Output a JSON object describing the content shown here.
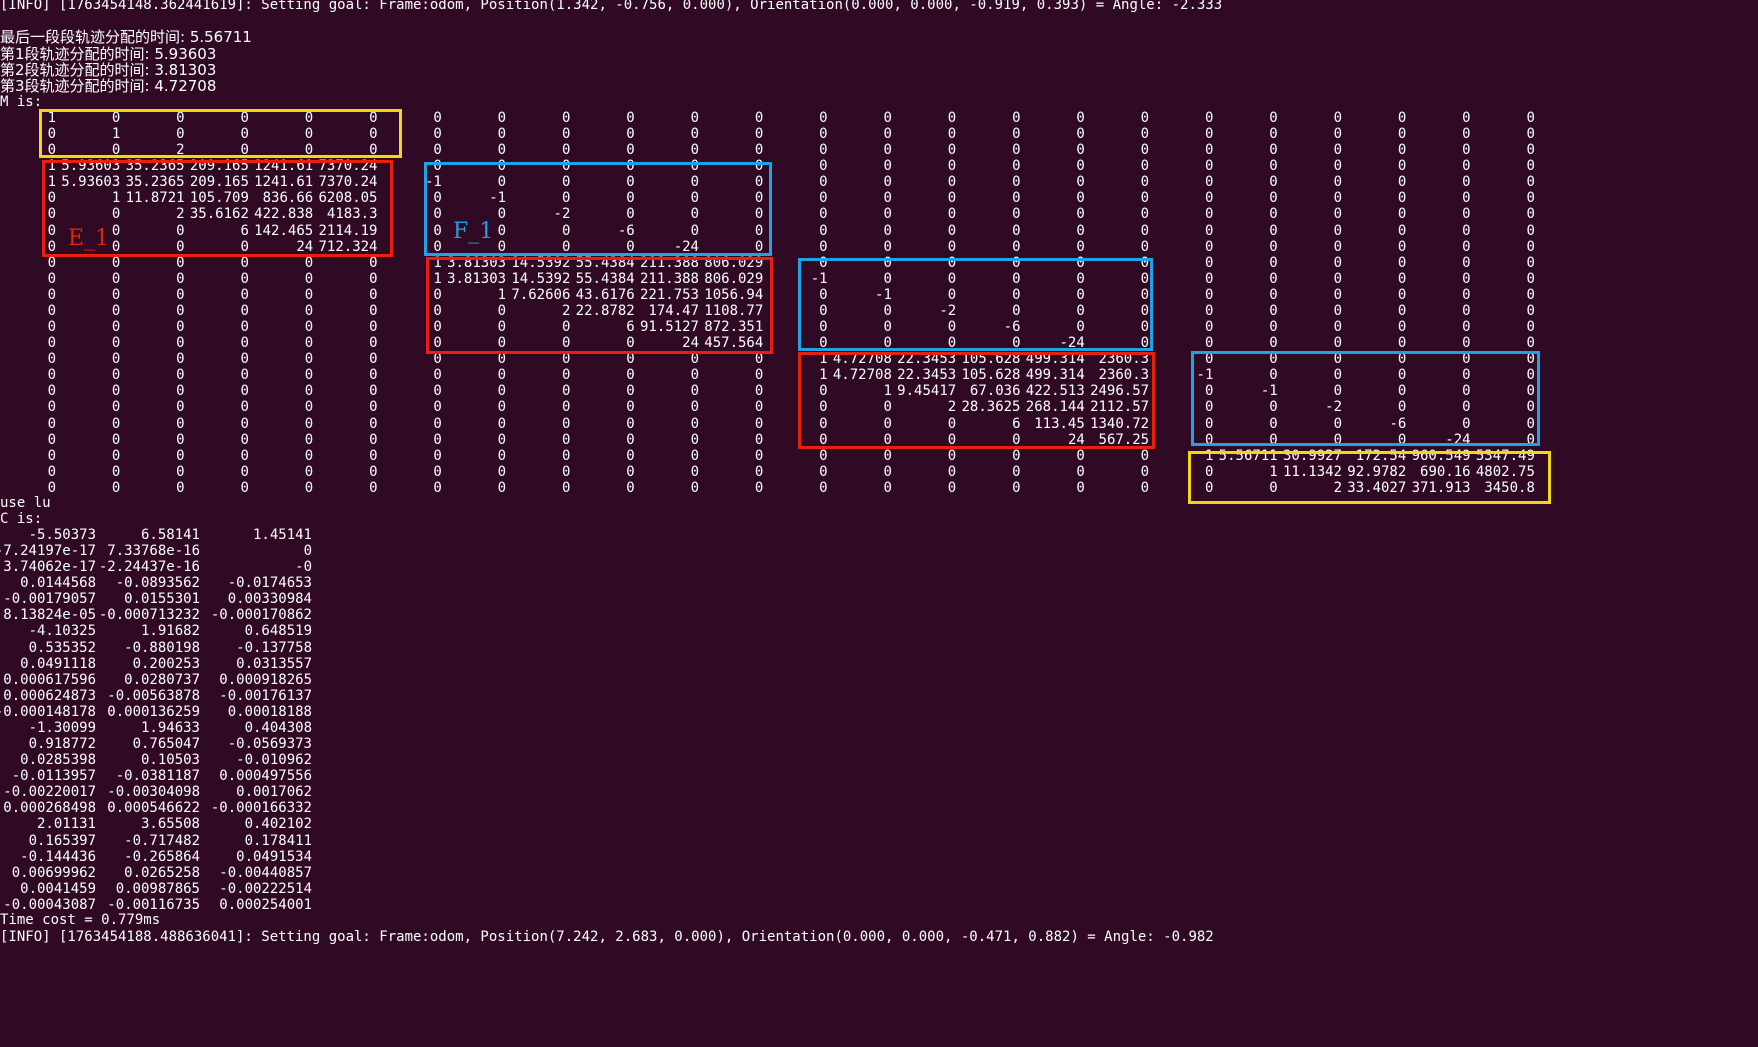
{
  "terminal": {
    "colors": {
      "background": "#300a24",
      "text": "#ffffff",
      "box_red": "#e8200e",
      "box_blue": "#1ea3e6",
      "box_yellow": "#f5d70d",
      "label_red": "#e8200e",
      "label_blue": "#1ea3e6"
    },
    "info_line": "[INFO] [1763454148.362441619]: Setting goal: Frame:odom, Position(1.342, -0.756, 0.000), Orientation(0.000, 0.000, -0.919, 0.393) = Angle: -2.333",
    "time_lines": [
      "最后一段段轨迹分配的时间: 5.56711",
      "第1段轨迹分配的时间: 5.93603",
      "第2段轨迹分配的时间: 3.81303",
      "第3段轨迹分配的时间: 4.72708"
    ],
    "m_header": "M is:",
    "m_rows": [
      [
        "1",
        "0",
        "0",
        "0",
        "0",
        "0",
        "0",
        "0",
        "0",
        "0",
        "0",
        "0",
        "0",
        "0",
        "0",
        "0",
        "0",
        "0",
        "0",
        "0",
        "0",
        "0",
        "0",
        "0"
      ],
      [
        "0",
        "1",
        "0",
        "0",
        "0",
        "0",
        "0",
        "0",
        "0",
        "0",
        "0",
        "0",
        "0",
        "0",
        "0",
        "0",
        "0",
        "0",
        "0",
        "0",
        "0",
        "0",
        "0",
        "0"
      ],
      [
        "0",
        "0",
        "2",
        "0",
        "0",
        "0",
        "0",
        "0",
        "0",
        "0",
        "0",
        "0",
        "0",
        "0",
        "0",
        "0",
        "0",
        "0",
        "0",
        "0",
        "0",
        "0",
        "0",
        "0"
      ],
      [
        "1",
        "5.93603",
        "35.2365",
        "209.165",
        "1241.61",
        "7370.24",
        "0",
        "0",
        "0",
        "0",
        "0",
        "0",
        "0",
        "0",
        "0",
        "0",
        "0",
        "0",
        "0",
        "0",
        "0",
        "0",
        "0",
        "0"
      ],
      [
        "1",
        "5.93603",
        "35.2365",
        "209.165",
        "1241.61",
        "7370.24",
        "-1",
        "0",
        "0",
        "0",
        "0",
        "0",
        "0",
        "0",
        "0",
        "0",
        "0",
        "0",
        "0",
        "0",
        "0",
        "0",
        "0",
        "0"
      ],
      [
        "0",
        "1",
        "11.8721",
        "105.709",
        "836.66",
        "6208.05",
        "0",
        "-1",
        "0",
        "0",
        "0",
        "0",
        "0",
        "0",
        "0",
        "0",
        "0",
        "0",
        "0",
        "0",
        "0",
        "0",
        "0",
        "0"
      ],
      [
        "0",
        "0",
        "2",
        "35.6162",
        "422.838",
        "4183.3",
        "0",
        "0",
        "-2",
        "0",
        "0",
        "0",
        "0",
        "0",
        "0",
        "0",
        "0",
        "0",
        "0",
        "0",
        "0",
        "0",
        "0",
        "0"
      ],
      [
        "0",
        "0",
        "0",
        "6",
        "142.465",
        "2114.19",
        "0",
        "0",
        "0",
        "-6",
        "0",
        "0",
        "0",
        "0",
        "0",
        "0",
        "0",
        "0",
        "0",
        "0",
        "0",
        "0",
        "0",
        "0"
      ],
      [
        "0",
        "0",
        "0",
        "0",
        "24",
        "712.324",
        "0",
        "0",
        "0",
        "0",
        "-24",
        "0",
        "0",
        "0",
        "0",
        "0",
        "0",
        "0",
        "0",
        "0",
        "0",
        "0",
        "0",
        "0"
      ],
      [
        "0",
        "0",
        "0",
        "0",
        "0",
        "0",
        "1",
        "3.81303",
        "14.5392",
        "55.4384",
        "211.388",
        "806.029",
        "0",
        "0",
        "0",
        "0",
        "0",
        "0",
        "0",
        "0",
        "0",
        "0",
        "0",
        "0"
      ],
      [
        "0",
        "0",
        "0",
        "0",
        "0",
        "0",
        "1",
        "3.81303",
        "14.5392",
        "55.4384",
        "211.388",
        "806.029",
        "-1",
        "0",
        "0",
        "0",
        "0",
        "0",
        "0",
        "0",
        "0",
        "0",
        "0",
        "0"
      ],
      [
        "0",
        "0",
        "0",
        "0",
        "0",
        "0",
        "0",
        "1",
        "7.62606",
        "43.6176",
        "221.753",
        "1056.94",
        "0",
        "-1",
        "0",
        "0",
        "0",
        "0",
        "0",
        "0",
        "0",
        "0",
        "0",
        "0"
      ],
      [
        "0",
        "0",
        "0",
        "0",
        "0",
        "0",
        "0",
        "0",
        "2",
        "22.8782",
        "174.47",
        "1108.77",
        "0",
        "0",
        "-2",
        "0",
        "0",
        "0",
        "0",
        "0",
        "0",
        "0",
        "0",
        "0"
      ],
      [
        "0",
        "0",
        "0",
        "0",
        "0",
        "0",
        "0",
        "0",
        "0",
        "6",
        "91.5127",
        "872.351",
        "0",
        "0",
        "0",
        "-6",
        "0",
        "0",
        "0",
        "0",
        "0",
        "0",
        "0",
        "0"
      ],
      [
        "0",
        "0",
        "0",
        "0",
        "0",
        "0",
        "0",
        "0",
        "0",
        "0",
        "24",
        "457.564",
        "0",
        "0",
        "0",
        "0",
        "-24",
        "0",
        "0",
        "0",
        "0",
        "0",
        "0",
        "0"
      ],
      [
        "0",
        "0",
        "0",
        "0",
        "0",
        "0",
        "0",
        "0",
        "0",
        "0",
        "0",
        "0",
        "1",
        "4.72708",
        "22.3453",
        "105.628",
        "499.314",
        "2360.3",
        "0",
        "0",
        "0",
        "0",
        "0",
        "0"
      ],
      [
        "0",
        "0",
        "0",
        "0",
        "0",
        "0",
        "0",
        "0",
        "0",
        "0",
        "0",
        "0",
        "1",
        "4.72708",
        "22.3453",
        "105.628",
        "499.314",
        "2360.3",
        "-1",
        "0",
        "0",
        "0",
        "0",
        "0"
      ],
      [
        "0",
        "0",
        "0",
        "0",
        "0",
        "0",
        "0",
        "0",
        "0",
        "0",
        "0",
        "0",
        "0",
        "1",
        "9.45417",
        "67.036",
        "422.513",
        "2496.57",
        "0",
        "-1",
        "0",
        "0",
        "0",
        "0"
      ],
      [
        "0",
        "0",
        "0",
        "0",
        "0",
        "0",
        "0",
        "0",
        "0",
        "0",
        "0",
        "0",
        "0",
        "0",
        "2",
        "28.3625",
        "268.144",
        "2112.57",
        "0",
        "0",
        "-2",
        "0",
        "0",
        "0"
      ],
      [
        "0",
        "0",
        "0",
        "0",
        "0",
        "0",
        "0",
        "0",
        "0",
        "0",
        "0",
        "0",
        "0",
        "0",
        "0",
        "6",
        "113.45",
        "1340.72",
        "0",
        "0",
        "0",
        "-6",
        "0",
        "0"
      ],
      [
        "0",
        "0",
        "0",
        "0",
        "0",
        "0",
        "0",
        "0",
        "0",
        "0",
        "0",
        "0",
        "0",
        "0",
        "0",
        "0",
        "24",
        "567.25",
        "0",
        "0",
        "0",
        "0",
        "-24",
        "0"
      ],
      [
        "0",
        "0",
        "0",
        "0",
        "0",
        "0",
        "0",
        "0",
        "0",
        "0",
        "0",
        "0",
        "0",
        "0",
        "0",
        "0",
        "0",
        "0",
        "1",
        "5.56711",
        "30.9927",
        "172.54",
        "960.549",
        "5347.49"
      ],
      [
        "0",
        "0",
        "0",
        "0",
        "0",
        "0",
        "0",
        "0",
        "0",
        "0",
        "0",
        "0",
        "0",
        "0",
        "0",
        "0",
        "0",
        "0",
        "0",
        "1",
        "11.1342",
        "92.9782",
        "690.16",
        "4802.75"
      ],
      [
        "0",
        "0",
        "0",
        "0",
        "0",
        "0",
        "0",
        "0",
        "0",
        "0",
        "0",
        "0",
        "0",
        "0",
        "0",
        "0",
        "0",
        "0",
        "0",
        "0",
        "2",
        "33.4027",
        "371.913",
        "3450.8"
      ]
    ],
    "use_lu": "use lu",
    "c_header": "C is:",
    "c_rows": [
      [
        "-5.50373",
        "6.58141",
        "1.45141"
      ],
      [
        "-7.24197e-17",
        "7.33768e-16",
        "0"
      ],
      [
        "3.74062e-17",
        "-2.24437e-16",
        "-0"
      ],
      [
        "0.0144568",
        "-0.0893562",
        "-0.0174653"
      ],
      [
        "-0.00179057",
        "0.0155301",
        "0.00330984"
      ],
      [
        "8.13824e-05",
        "-0.000713232",
        "-0.000170862"
      ],
      [
        "-4.10325",
        "1.91682",
        "0.648519"
      ],
      [
        "0.535352",
        "-0.880198",
        "-0.137758"
      ],
      [
        "0.0491118",
        "0.200253",
        "0.0313557"
      ],
      [
        "0.000617596",
        "0.0280737",
        "0.000918265"
      ],
      [
        "0.000624873",
        "-0.00563878",
        "-0.00176137"
      ],
      [
        "-0.000148178",
        "0.000136259",
        "0.00018188"
      ],
      [
        "-1.30099",
        "1.94633",
        "0.404308"
      ],
      [
        "0.918772",
        "0.765047",
        "-0.0569373"
      ],
      [
        "0.0285398",
        "0.10503",
        "-0.010962"
      ],
      [
        "-0.0113957",
        "-0.0381187",
        "0.000497556"
      ],
      [
        "-0.00220017",
        "-0.00304098",
        "0.0017062"
      ],
      [
        "0.000268498",
        "0.000546622",
        "-0.000166332"
      ],
      [
        "2.01131",
        "3.65508",
        "0.402102"
      ],
      [
        "0.165397",
        "-0.717482",
        "0.178411"
      ],
      [
        "-0.144436",
        "-0.265864",
        "0.0491534"
      ],
      [
        "0.00699962",
        "0.0265258",
        "-0.00440857"
      ],
      [
        "0.0041459",
        "0.00987865",
        "-0.00222514"
      ],
      [
        "-0.00043087",
        "-0.00116735",
        "0.000254001"
      ]
    ],
    "time_cost": "Time cost = 0.779ms",
    "bottom_partial": "[INFO] [1763454188.488636041]: Setting goal: Frame:odom, Position(7.242, 2.683, 0.000), Orientation(0.000, 0.000, -0.471, 0.882) = Angle: -0.982",
    "annotations": {
      "e1_label": "E_1",
      "f1_label": "F_1"
    }
  }
}
